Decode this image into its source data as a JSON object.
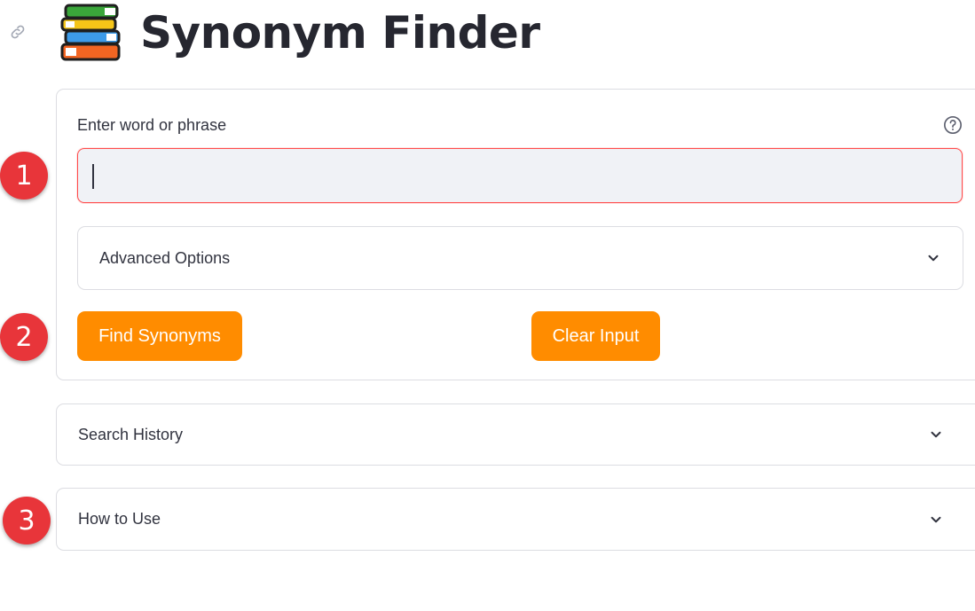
{
  "header": {
    "title": "Synonym Finder",
    "icon": "books-icon",
    "anchor_icon": "link-icon"
  },
  "form": {
    "input_label": "Enter word or phrase",
    "input_value": "",
    "help_icon": "question-circle-icon",
    "advanced_options_label": "Advanced Options",
    "find_button_label": "Find Synonyms",
    "clear_button_label": "Clear Input"
  },
  "expanders": {
    "search_history_label": "Search History",
    "how_to_use_label": "How to Use"
  },
  "annotations": {
    "marker_1": "1",
    "marker_2": "2",
    "marker_3": "3"
  },
  "colors": {
    "accent_orange": "#ff8c00",
    "focus_red": "#ff4b4b",
    "marker_red": "#e8353a",
    "input_bg": "#f0f2f6"
  }
}
